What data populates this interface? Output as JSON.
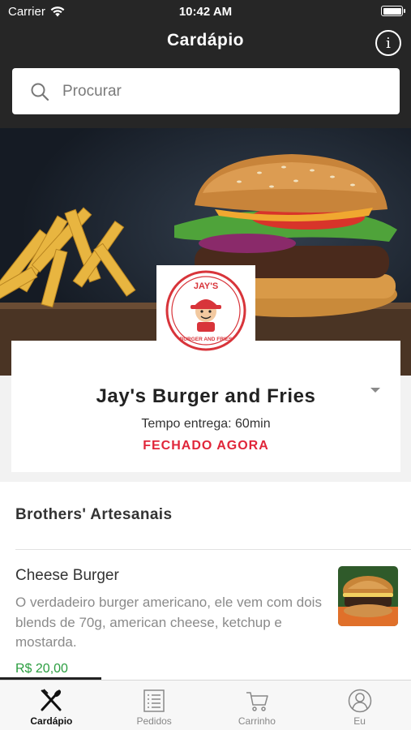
{
  "status_bar": {
    "carrier": "Carrier",
    "time": "10:42 AM"
  },
  "nav": {
    "title": "Cardápio"
  },
  "search": {
    "placeholder": "Procurar"
  },
  "restaurant": {
    "logo_text_top": "JAY'S",
    "logo_text_bottom": "BURGER AND FRIES",
    "name": "Jay's Burger and Fries",
    "delivery_time": "Tempo entrega: 60min",
    "status": "FECHADO AGORA"
  },
  "menu": {
    "section_title": "Brothers' Artesanais",
    "items": [
      {
        "name": "Cheese Burger",
        "description": "O verdadeiro burger americano, ele vem com dois blends de 70g, american cheese, ketchup e mostarda.",
        "price": "R$ 20,00"
      }
    ]
  },
  "tabs": [
    {
      "label": "Cardápio",
      "icon": "fork-knife-icon",
      "active": true
    },
    {
      "label": "Pedidos",
      "icon": "list-icon",
      "active": false
    },
    {
      "label": "Carrinho",
      "icon": "cart-icon",
      "active": false
    },
    {
      "label": "Eu",
      "icon": "user-icon",
      "active": false
    }
  ],
  "colors": {
    "topbar": "#262626",
    "closed": "#e0263a",
    "price": "#2a9d3f"
  }
}
